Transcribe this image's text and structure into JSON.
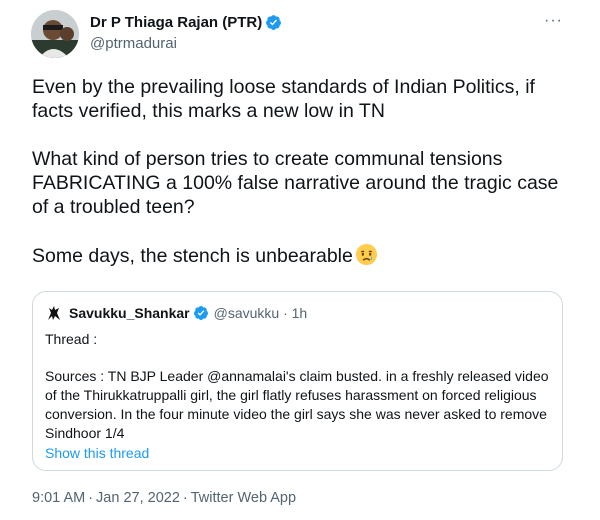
{
  "author": {
    "display_name": "Dr P Thiaga Rajan (PTR)",
    "handle": "@ptrmadurai",
    "verified": true,
    "avatar_icon": "profile-photo",
    "more_label": "···"
  },
  "tweet": {
    "paragraphs": [
      "Even by the prevailing loose standards of Indian Politics, if facts verified, this marks a new low in TN",
      "What kind of person tries to create communal tensions FABRICATING a 100% false narrative around the tragic case of a troubled teen?",
      "Some days, the stench is unbearable"
    ],
    "trailing_emoji": "crying-face"
  },
  "quoted": {
    "display_name": "Savukku_Shankar",
    "handle_time": "@savukku · 1h",
    "verified": true,
    "avatar_icon": "silhouette-logo",
    "line1": "Thread :",
    "line2": "Sources : TN BJP Leader @annamalai's claim busted. in a freshly released video of the Thirukkatruppalli girl, the girl flatly refuses harassment on forced religious conversion.  In the four minute video the girl says she was never asked to remove Sindhoor 1/4",
    "show_thread": "Show this thread"
  },
  "meta": {
    "time": "9:01 AM",
    "date": "Jan 27, 2022",
    "source": "Twitter Web App",
    "separator": "·"
  },
  "colors": {
    "text": "#0f1419",
    "secondary": "#536471",
    "link": "#1d9bf0",
    "border": "#cfd9de",
    "verified": "#1d9bf0"
  }
}
